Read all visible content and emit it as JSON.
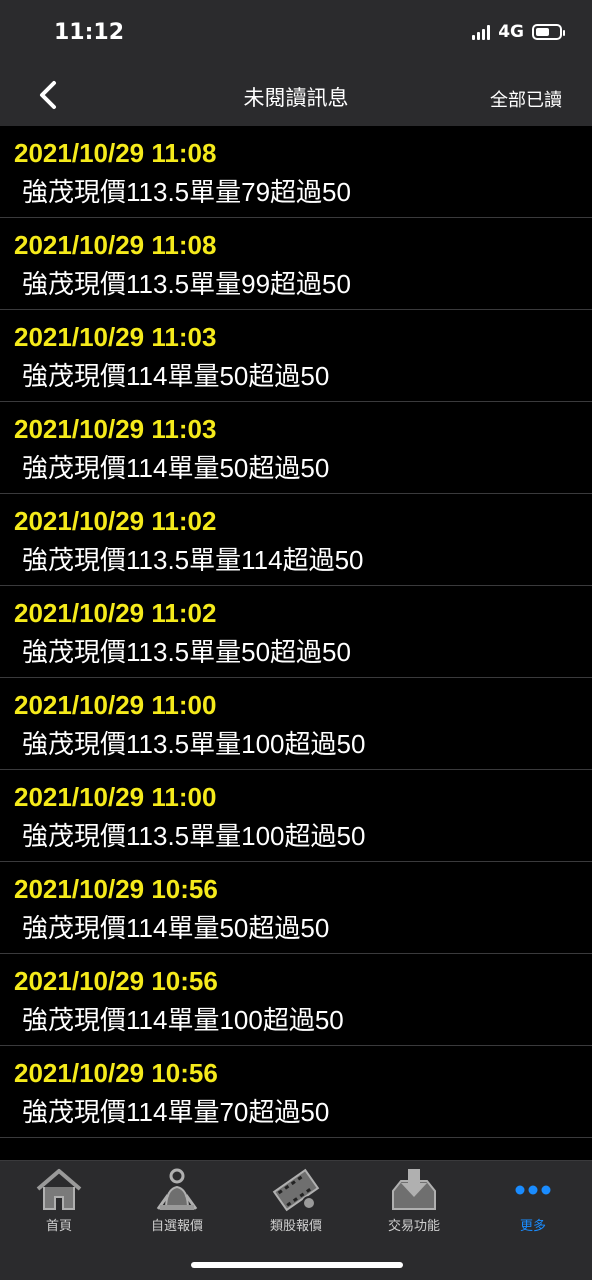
{
  "status_bar": {
    "time": "11:12",
    "network": "4G"
  },
  "nav": {
    "title": "未閱讀訊息",
    "mark_all_read": "全部已讀"
  },
  "messages": [
    {
      "time": "2021/10/29 11:08",
      "text": "強茂現價113.5單量79超過50"
    },
    {
      "time": "2021/10/29 11:08",
      "text": "強茂現價113.5單量99超過50"
    },
    {
      "time": "2021/10/29 11:03",
      "text": "強茂現價114單量50超過50"
    },
    {
      "time": "2021/10/29 11:03",
      "text": "強茂現價114單量50超過50"
    },
    {
      "time": "2021/10/29 11:02",
      "text": "強茂現價113.5單量114超過50"
    },
    {
      "time": "2021/10/29 11:02",
      "text": "強茂現價113.5單量50超過50"
    },
    {
      "time": "2021/10/29 11:00",
      "text": "強茂現價113.5單量100超過50"
    },
    {
      "time": "2021/10/29 11:00",
      "text": "強茂現價113.5單量100超過50"
    },
    {
      "time": "2021/10/29 10:56",
      "text": "強茂現價114單量50超過50"
    },
    {
      "time": "2021/10/29 10:56",
      "text": "強茂現價114單量100超過50"
    },
    {
      "time": "2021/10/29 10:56",
      "text": "強茂現價114單量70超過50"
    }
  ],
  "tabs": [
    {
      "label": "首頁",
      "icon": "home-icon"
    },
    {
      "label": "自選報價",
      "icon": "watchlist-icon"
    },
    {
      "label": "類股報價",
      "icon": "sector-film-icon"
    },
    {
      "label": "交易功能",
      "icon": "trade-download-icon"
    },
    {
      "label": "更多",
      "icon": "more-dots-icon",
      "active": true
    }
  ],
  "colors": {
    "timestamp": "#f5ea1b",
    "active_tab": "#1a8cff",
    "bar_bg": "#2b2b2d"
  }
}
